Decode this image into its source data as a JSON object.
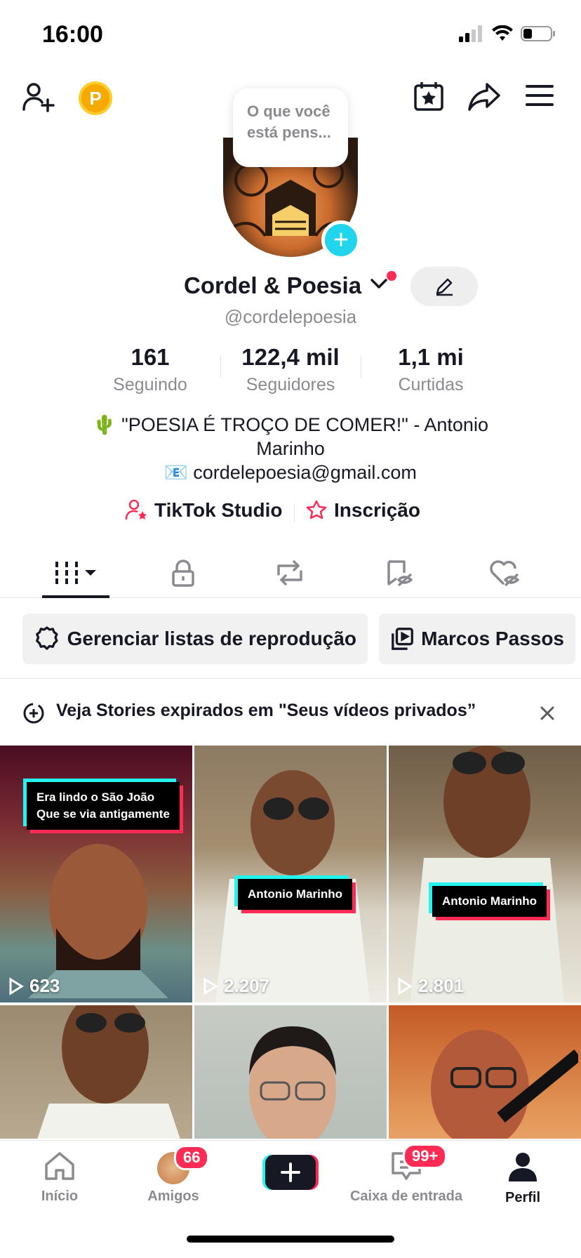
{
  "status_bar": {
    "time": "16:00"
  },
  "bubble": {
    "text": "O que você está pens..."
  },
  "profile": {
    "name": "Cordel & Poesia",
    "handle": "@cordelepoesia",
    "stats": [
      {
        "value": "161",
        "label": "Seguindo"
      },
      {
        "value": "122,4 mil",
        "label": "Seguidores"
      },
      {
        "value": "1,1 mi",
        "label": "Curtidas"
      }
    ],
    "bio_line1": "🌵 \"POESIA É TROÇO DE COMER!\" - Antonio Marinho",
    "bio_line2": "📧 cordelepoesia@gmail.com"
  },
  "links": {
    "studio": "TikTok Studio",
    "subscription": "Inscrição"
  },
  "playlists": {
    "manage": "Gerenciar listas de reprodução",
    "playlist1": "Marcos Passos"
  },
  "stories_banner": {
    "text": "Veja Stories expirados em \"Seus vídeos privados”"
  },
  "videos": [
    {
      "overlay": "Era lindo o São João\nQue se via antigamente",
      "views": "623"
    },
    {
      "overlay": "Antonio Marinho",
      "views": "2.207"
    },
    {
      "overlay": "Antonio Marinho",
      "views": "2.801"
    },
    {
      "overlay": "",
      "views": ""
    },
    {
      "overlay": "",
      "views": ""
    },
    {
      "overlay": "",
      "views": ""
    }
  ],
  "nav": {
    "home": "Início",
    "friends": "Amigos",
    "friends_badge": "66",
    "inbox": "Caixa de entrada",
    "inbox_badge": "99+",
    "profile": "Perfil"
  },
  "colors": {
    "accent_red": "#fe2c55",
    "accent_cyan": "#25f4ee",
    "text": "#161823",
    "muted": "#8a8b91"
  }
}
